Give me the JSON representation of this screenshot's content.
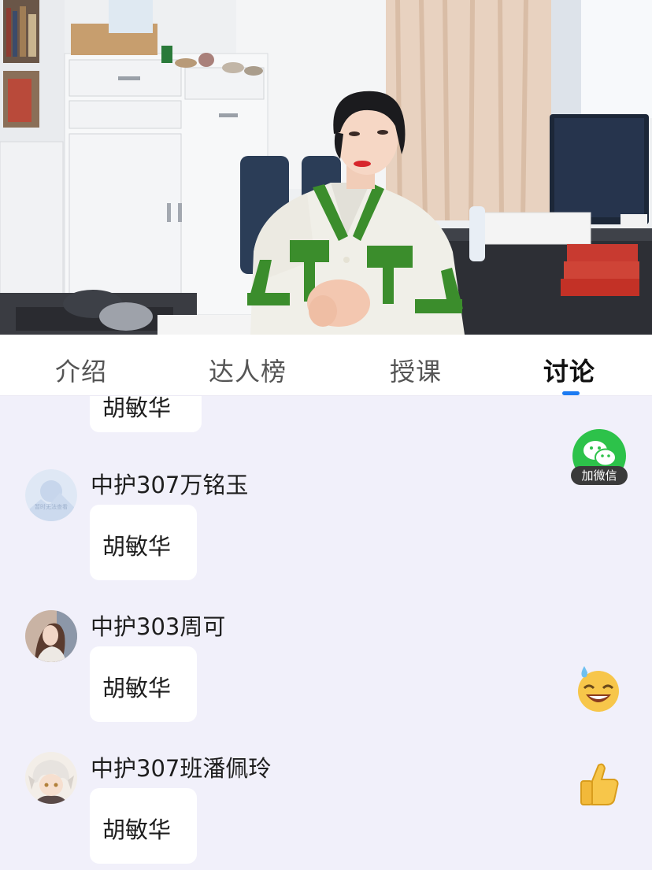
{
  "tabs": [
    {
      "label": "介绍",
      "active": false
    },
    {
      "label": "达人榜",
      "active": false
    },
    {
      "label": "授课",
      "active": false
    },
    {
      "label": "讨论",
      "active": true
    }
  ],
  "accent_color": "#1c7bf2",
  "feed": {
    "partial_message": {
      "text": "胡敏华"
    },
    "comments": [
      {
        "user": "中护307万铭玉",
        "avatar_text": "暂时无法查看",
        "message": "胡敏华"
      },
      {
        "user": "中护303周可",
        "message": "胡敏华"
      },
      {
        "user": "中护307班潘佩玲",
        "message": "胡敏华"
      }
    ]
  },
  "wechat_button": {
    "label": "加微信",
    "color": "#2dc24a"
  },
  "floating_emojis": [
    "laughing-sweat-emoji",
    "thumbs-up-emoji"
  ]
}
